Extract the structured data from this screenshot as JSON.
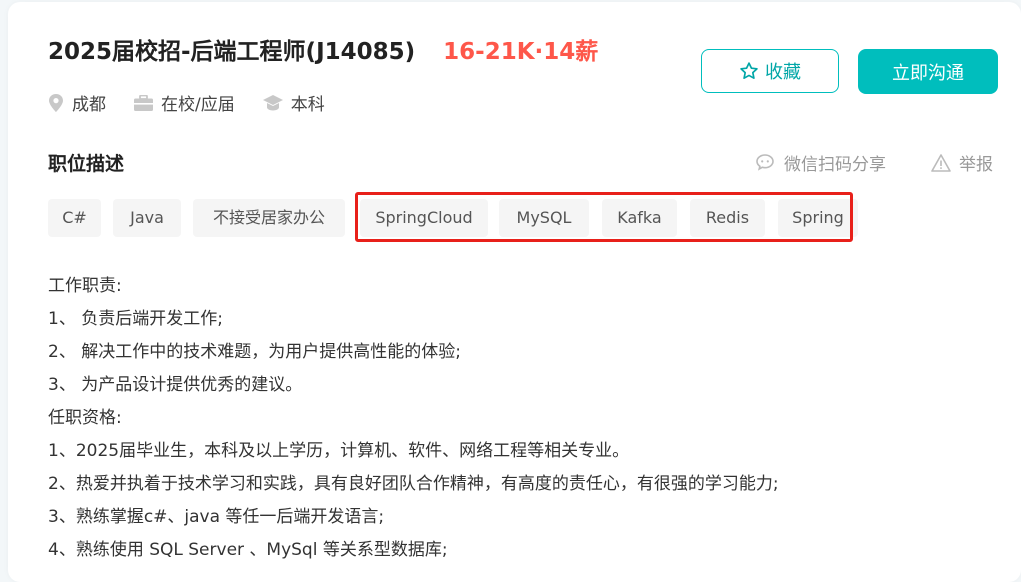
{
  "job": {
    "title": "2025届校招-后端工程师(J14085)",
    "salary": "16-21K·14薪",
    "city": "成都",
    "experience": "在校/应届",
    "degree": "本科"
  },
  "actions": {
    "favorite_label": "收藏",
    "chat_label": "立即沟通"
  },
  "section": {
    "title": "职位描述",
    "share_label": "微信扫码分享",
    "report_label": "举报"
  },
  "tags": [
    "C#",
    "Java",
    "不接受居家办公",
    "SpringCloud",
    "MySQL",
    "Kafka",
    "Redis",
    "Spring"
  ],
  "description": [
    "工作职责:",
    "1、 负责后端开发工作;",
    "2、 解决工作中的技术难题，为用户提供高性能的体验;",
    "3、 为产品设计提供优秀的建议。",
    "任职资格:",
    "1、2025届毕业生，本科及以上学历，计算机、软件、网络工程等相关专业。",
    "2、热爱并执着于技术学习和实践，具有良好团队合作精神，有高度的责任心，有很强的学习能力;",
    "3、熟练掌握c#、java 等任一后端开发语言;",
    "4、熟练使用 SQL Server 、MySql 等关系型数据库;"
  ],
  "colors": {
    "accent": "#00bebd",
    "salary": "#fe574a",
    "highlight": "#e8201a"
  }
}
